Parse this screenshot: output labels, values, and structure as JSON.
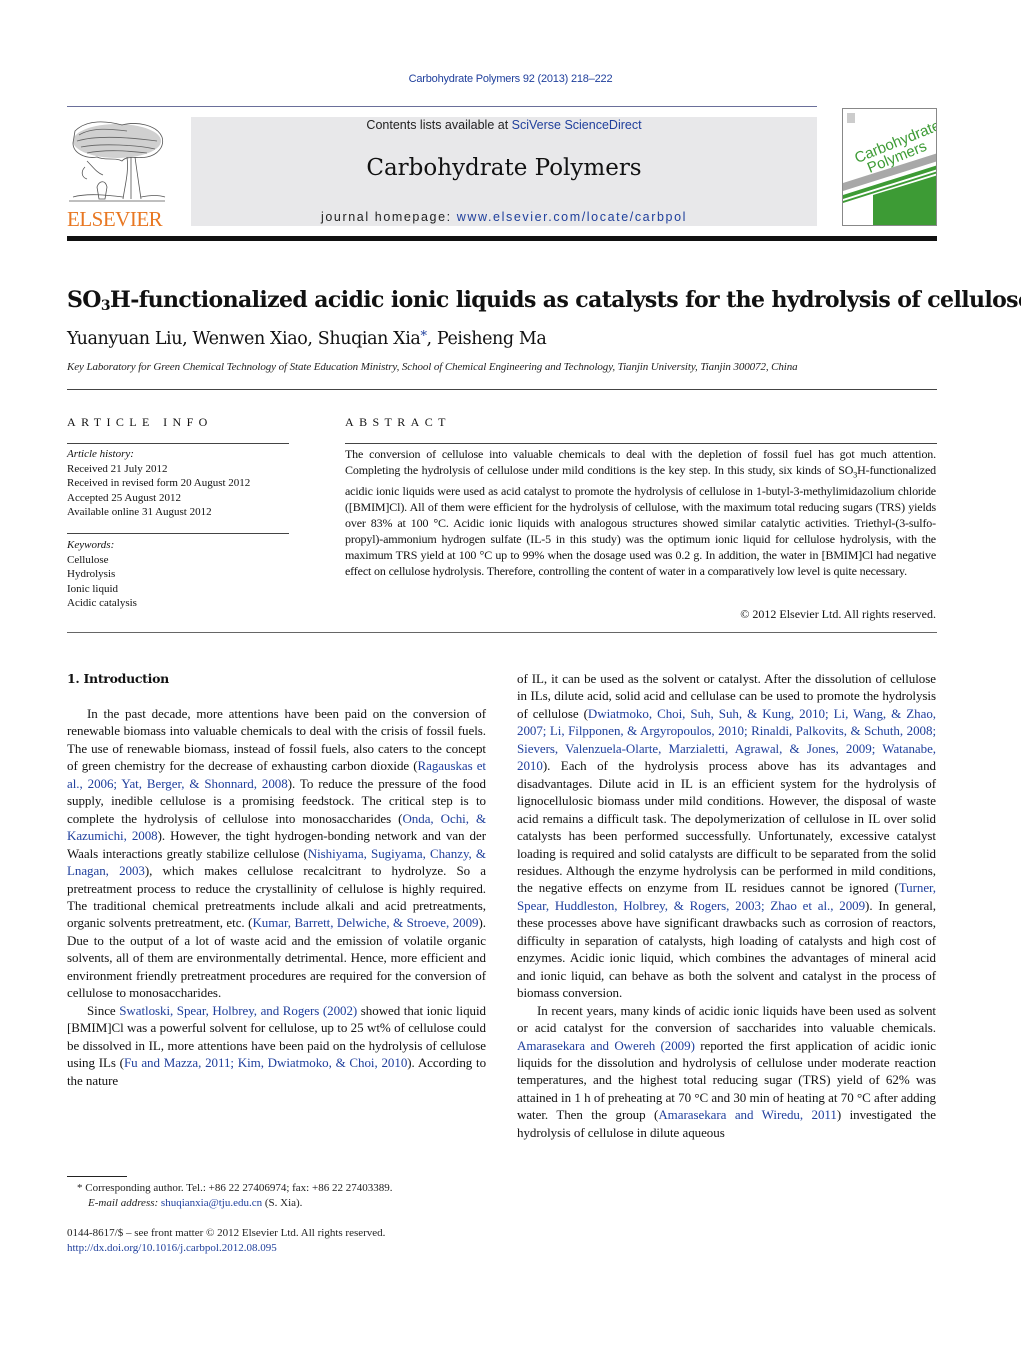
{
  "header": {
    "journal_citation": "Carbohydrate Polymers 92 (2013) 218–222",
    "contents_prefix": "Contents lists available at ",
    "contents_link": "SciVerse ScienceDirect",
    "journal_name": "Carbohydrate Polymers",
    "homepage_prefix": "journal homepage: ",
    "homepage_link": "www.elsevier.com/locate/carbpol",
    "publisher_logo_text": "ELSEVIER",
    "cover_title_line1": "Carbohydrate",
    "cover_title_line2": "Polymers",
    "colors": {
      "link": "#1f3f9c",
      "elsevier_orange": "#e87722",
      "cover_green": "#3d9b35",
      "masthead_bg": "#e8e8ea"
    }
  },
  "article": {
    "title_prefix": "SO",
    "title_sub": "3",
    "title_rest": "H-functionalized acidic ionic liquids as catalysts for the hydrolysis of cellulose",
    "authors_part1": "Yuanyuan Liu, Wenwen Xiao, Shuqian Xia",
    "authors_star": "*",
    "authors_part2": ", Peisheng Ma",
    "affiliation": "Key Laboratory for Green Chemical Technology of State Education Ministry, School of Chemical Engineering and Technology, Tianjin University, Tianjin 300072, China"
  },
  "article_info": {
    "heading": "ARTICLE INFO",
    "history_label": "Article history:",
    "history": [
      "Received 21 July 2012",
      "Received in revised form 20 August 2012",
      "Accepted 25 August 2012",
      "Available online 31 August 2012"
    ],
    "keywords_label": "Keywords:",
    "keywords": [
      "Cellulose",
      "Hydrolysis",
      "Ionic liquid",
      "Acidic catalysis"
    ]
  },
  "abstract": {
    "heading": "ABSTRACT",
    "text_a": "The conversion of cellulose into valuable chemicals to deal with the depletion of fossil fuel has got much attention. Completing the hydrolysis of cellulose under mild conditions is the key step. In this study, six kinds of SO",
    "text_sub": "3",
    "text_b": "H-functionalized acidic ionic liquids were used as acid catalyst to promote the hydrolysis of cellulose in 1-butyl-3-methylimidazolium chloride ([BMIM]Cl). All of them were efficient for the hydrolysis of cellulose, with the maximum total reducing sugars (TRS) yields over 83% at 100 °C. Acidic ionic liquids with analogous structures showed similar catalytic activities. Triethyl-(3-sulfo-propyl)-ammonium hydrogen sulfate (IL-5 in this study) was the optimum ionic liquid for cellulose hydrolysis, with the maximum TRS yield at 100 °C up to 99% when the dosage used was 0.2 g. In addition, the water in [BMIM]Cl had negative effect on cellulose hydrolysis. Therefore, controlling the content of water in a comparatively low level is quite necessary.",
    "copyright": "© 2012 Elsevier Ltd. All rights reserved."
  },
  "body": {
    "section_heading": "1.  Introduction",
    "left": {
      "p1": [
        {
          "t": "In the past decade, more attentions have been paid on the conversion of renewable biomass into valuable chemicals to deal with the crisis of fossil fuels. The use of renewable biomass, instead of fossil fuels, also caters to the concept of green chemistry for the decrease of exhausting carbon dioxide ("
        },
        {
          "l": "Ragauskas et al., 2006; Yat, Berger, & Shonnard, 2008"
        },
        {
          "t": "). To reduce the pressure of the food supply, inedible cellulose is a promising feedstock. The critical step is to complete the hydrolysis of cellulose into monosaccharides ("
        },
        {
          "l": "Onda, Ochi, & Kazumichi, 2008"
        },
        {
          "t": "). However, the tight hydrogen-bonding network and van der Waals interactions greatly stabilize cellulose ("
        },
        {
          "l": "Nishiyama, Sugiyama, Chanzy, & Lnagan, 2003"
        },
        {
          "t": "), which makes cellulose recalcitrant to hydrolyze. So a pretreatment process to reduce the crystallinity of cellulose is highly required. The traditional chemical pretreatments include alkali and acid pretreatments, organic solvents pretreatment, etc. ("
        },
        {
          "l": "Kumar, Barrett, Delwiche, & Stroeve, 2009"
        },
        {
          "t": "). Due to the output of a lot of waste acid and the emission of volatile organic solvents, all of them are environmentally detrimental. Hence, more efficient and environment friendly pretreatment procedures are required for the conversion of cellulose to monosaccharides."
        }
      ],
      "p2": [
        {
          "t": "Since "
        },
        {
          "l": "Swatloski, Spear, Holbrey, and Rogers (2002)"
        },
        {
          "t": " showed that ionic liquid [BMIM]Cl was a powerful solvent for cellulose, up to 25 wt% of cellulose could be dissolved in IL, more attentions have been paid on the hydrolysis of cellulose using ILs ("
        },
        {
          "l": "Fu and Mazza, 2011; Kim, Dwiatmoko, & Choi, 2010"
        },
        {
          "t": "). According to the nature"
        }
      ]
    },
    "right": {
      "p1": [
        {
          "t": "of IL, it can be used as the solvent or catalyst. After the dissolution of cellulose in ILs, dilute acid, solid acid and cellulase can be used to promote the hydrolysis of cellulose ("
        },
        {
          "l": "Dwiatmoko, Choi, Suh, Suh, & Kung, 2010; Li, Wang, & Zhao, 2007; Li, Filpponen, & Argyropoulos, 2010; Rinaldi, Palkovits, & Schuth, 2008; Sievers, Valenzuela-Olarte, Marzialetti, Agrawal, & Jones, 2009; Watanabe, 2010"
        },
        {
          "t": "). Each of the hydrolysis process above has its advantages and disadvantages. Dilute acid in IL is an efficient system for the hydrolysis of lignocellulosic biomass under mild conditions. However, the disposal of waste acid remains a difficult task. The depolymerization of cellulose in IL over solid catalysts has been performed successfully. Unfortunately, excessive catalyst loading is required and solid catalysts are difficult to be separated from the solid residues. Although the enzyme hydrolysis can be performed in mild conditions, the negative effects on enzyme from IL residues cannot be ignored ("
        },
        {
          "l": "Turner, Spear, Huddleston, Holbrey, & Rogers, 2003; Zhao et al., 2009"
        },
        {
          "t": "). In general, these processes above have significant drawbacks such as corrosion of reactors, difficulty in separation of catalysts, high loading of catalysts and high cost of enzymes. Acidic ionic liquid, which combines the advantages of mineral acid and ionic liquid, can behave as both the solvent and catalyst in the process of biomass conversion."
        }
      ],
      "p2": [
        {
          "t": "In recent years, many kinds of acidic ionic liquids have been used as solvent or acid catalyst for the conversion of saccharides into valuable chemicals. "
        },
        {
          "l": "Amarasekara and Owereh (2009)"
        },
        {
          "t": " reported the first application of acidic ionic liquids for the dissolution and hydrolysis of cellulose under moderate reaction temperatures, and the highest total reducing sugar (TRS) yield of 62% was attained in 1 h of preheating at 70 °C and 30 min of heating at 70 °C after adding water. Then the group ("
        },
        {
          "l": "Amarasekara and Wiredu, 2011"
        },
        {
          "t": ") investigated the hydrolysis of cellulose in dilute aqueous"
        }
      ]
    }
  },
  "footnotes": {
    "corresponding_star": "*",
    "corresponding": " Corresponding author. Tel.: +86 22 27406974; fax: +86 22 27403389.",
    "email_label": "E-mail address: ",
    "email": "shuqianxia@tju.edu.cn",
    "email_suffix": " (S. Xia).",
    "frontmatter": "0144-8617/$ – see front matter © 2012 Elsevier Ltd. All rights reserved.",
    "doi": "http://dx.doi.org/10.1016/j.carbpol.2012.08.095"
  }
}
